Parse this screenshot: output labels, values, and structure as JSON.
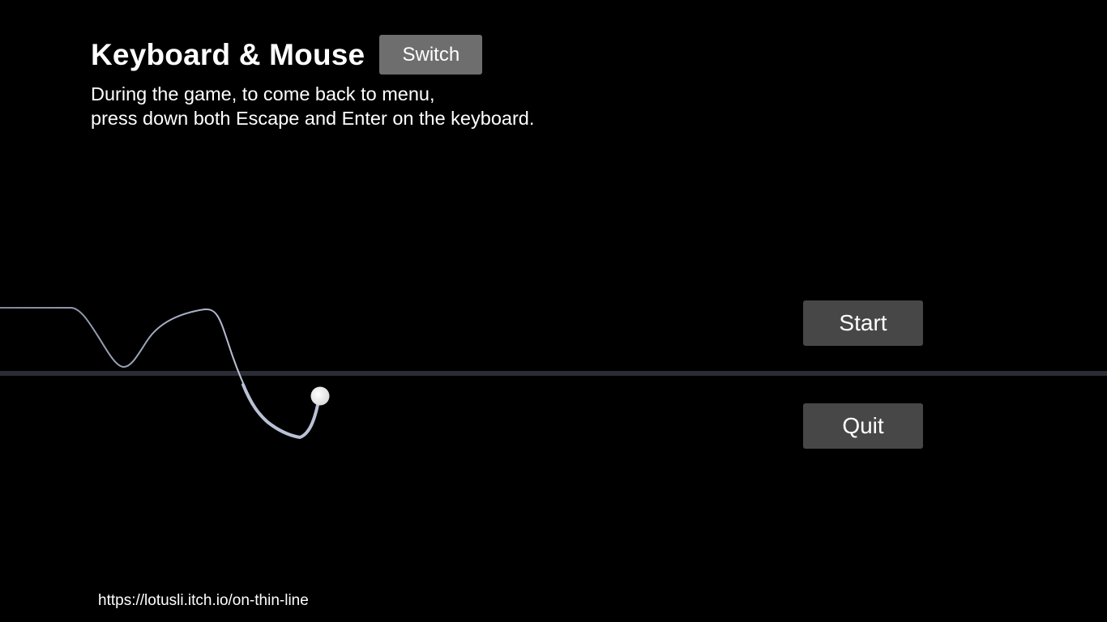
{
  "header": {
    "title": "Keyboard & Mouse",
    "switch_label": "Switch"
  },
  "instructions": {
    "line1": "During the game, to come back to menu,",
    "line2": "press down both Escape and Enter on the keyboard."
  },
  "menu": {
    "start_label": "Start",
    "quit_label": "Quit"
  },
  "footer": {
    "link_text": "https://lotusli.itch.io/on-thin-line"
  },
  "colors": {
    "background": "#000000",
    "text": "#ffffff",
    "switch_button": "#6e6e6e",
    "menu_button": "#474747",
    "ground_line": "#2a2d36",
    "trail": "#aeb6cc",
    "ball": "#ffffff"
  }
}
